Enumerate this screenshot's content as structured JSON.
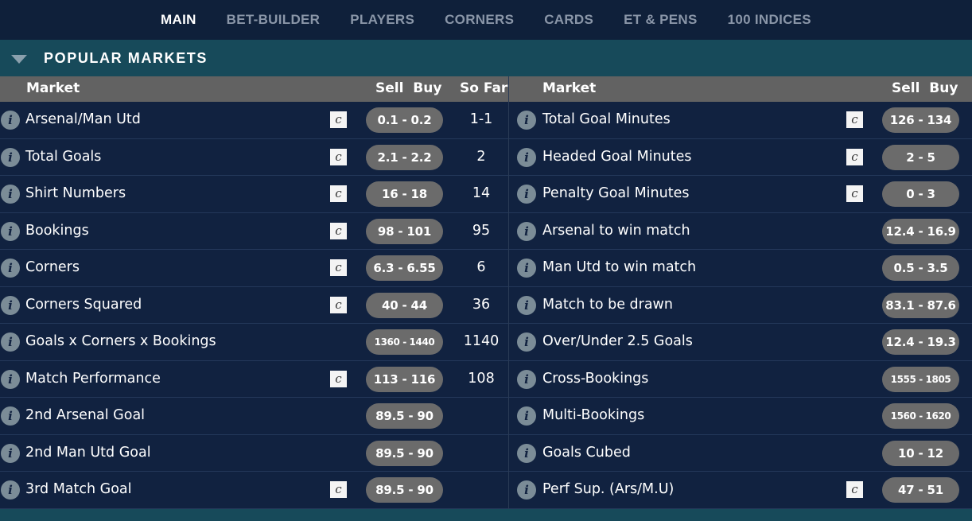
{
  "nav": {
    "tabs": [
      {
        "label": "MAIN",
        "active": true
      },
      {
        "label": "BET-BUILDER",
        "active": false
      },
      {
        "label": "PLAYERS",
        "active": false
      },
      {
        "label": "CORNERS",
        "active": false
      },
      {
        "label": "CARDS",
        "active": false
      },
      {
        "label": "ET & PENS",
        "active": false
      },
      {
        "label": "100 INDICES",
        "active": false
      }
    ]
  },
  "section": {
    "title": "POPULAR MARKETS"
  },
  "icons": {
    "info_glyph": "i",
    "c_glyph": "c"
  },
  "colors": {
    "background": "#112240",
    "section_header": "#174a5a",
    "column_header": "#626262",
    "price_pill": "#6b6b6b"
  },
  "left": {
    "headers": {
      "market": "Market",
      "sell_buy": "Sell  Buy",
      "so_far": "So Far"
    },
    "rows": [
      {
        "market": "Arsenal/Man Utd",
        "price": "0.1 - 0.2",
        "so_far": "1-1",
        "c": true
      },
      {
        "market": "Total Goals",
        "price": "2.1 - 2.2",
        "so_far": "2",
        "c": true
      },
      {
        "market": "Shirt Numbers",
        "price": "16 - 18",
        "so_far": "14",
        "c": true
      },
      {
        "market": "Bookings",
        "price": "98 - 101",
        "so_far": "95",
        "c": true
      },
      {
        "market": "Corners",
        "price": "6.3 - 6.55",
        "so_far": "6",
        "c": true
      },
      {
        "market": "Corners Squared",
        "price": "40 - 44",
        "so_far": "36",
        "c": true
      },
      {
        "market": "Goals x Corners x Bookings",
        "price": "1360 - 1440",
        "so_far": "1140",
        "c": false,
        "small": true
      },
      {
        "market": "Match Performance",
        "price": "113 - 116",
        "so_far": "108",
        "c": true
      },
      {
        "market": "2nd Arsenal Goal",
        "price": "89.5 - 90",
        "so_far": "",
        "c": false
      },
      {
        "market": "2nd Man Utd Goal",
        "price": "89.5 - 90",
        "so_far": "",
        "c": false
      },
      {
        "market": "3rd Match Goal",
        "price": "89.5 - 90",
        "so_far": "",
        "c": true
      }
    ]
  },
  "right": {
    "headers": {
      "market": "Market",
      "sell_buy": "Sell  Buy"
    },
    "rows": [
      {
        "market": "Total Goal Minutes",
        "price": "126 - 134",
        "c": true
      },
      {
        "market": "Headed Goal Minutes",
        "price": "2 - 5",
        "c": true
      },
      {
        "market": "Penalty Goal Minutes",
        "price": "0 - 3",
        "c": true
      },
      {
        "market": "Arsenal to win match",
        "price": "12.4 - 16.9",
        "c": false
      },
      {
        "market": "Man Utd to win match",
        "price": "0.5 - 3.5",
        "c": false
      },
      {
        "market": "Match to be drawn",
        "price": "83.1 - 87.6",
        "c": false
      },
      {
        "market": "Over/Under 2.5 Goals",
        "price": "12.4 - 19.3",
        "c": false
      },
      {
        "market": "Cross-Bookings",
        "price": "1555 - 1805",
        "c": false,
        "small": true
      },
      {
        "market": "Multi-Bookings",
        "price": "1560 - 1620",
        "c": false,
        "small": true
      },
      {
        "market": "Goals Cubed",
        "price": "10 - 12",
        "c": false
      },
      {
        "market": "Perf Sup. (Ars/M.U)",
        "price": "47 - 51",
        "c": true
      }
    ]
  }
}
